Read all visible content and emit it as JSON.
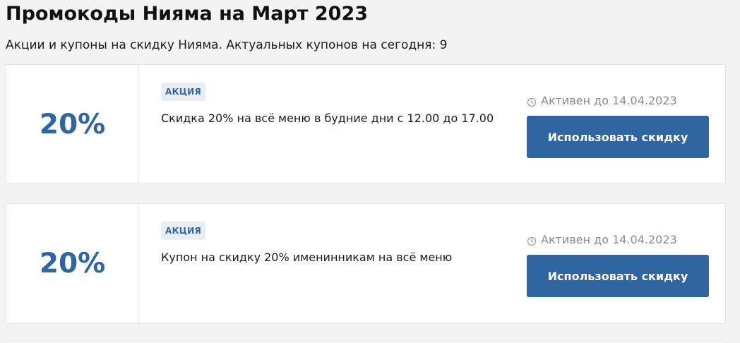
{
  "page": {
    "title": "Промокоды Нияма на Март 2023",
    "subtitle": "Акции и купоны на скидку Нияма. Актуальных купонов на сегодня: 9"
  },
  "coupons": [
    {
      "value": "20%",
      "badge": "АКЦИЯ",
      "description": "Скидка 20% на всё меню в будние дни с 12.00 до 17.00",
      "expiry": "Активен до 14.04.2023",
      "expiry_icon": "clock-icon",
      "button_label": "Использовать скидку"
    },
    {
      "value": "20%",
      "badge": "АКЦИЯ",
      "description": "Купон на скидку 20% именинникам на всё меню",
      "expiry": "Активен до 14.04.2023",
      "expiry_icon": "clock-icon",
      "button_label": "Использовать скидку"
    }
  ],
  "colors": {
    "accent": "#2f66a2",
    "badge_bg": "#e9eef5",
    "muted_text": "#8a8a8a",
    "background": "#f3f3f3"
  }
}
